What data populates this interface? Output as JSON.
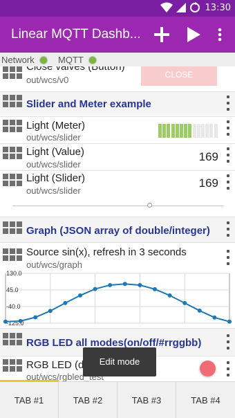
{
  "status_bar": {
    "time": "13:30"
  },
  "app_bar": {
    "title": "Linear MQTT Dashb...",
    "actions": [
      "add-icon",
      "play-icon",
      "overflow-menu-icon"
    ]
  },
  "connection": {
    "network_label": "Network",
    "mqtt_label": "MQTT",
    "network_status_color": "#7cb342",
    "mqtt_status_color": "#7cb342"
  },
  "widgets": {
    "close_valves": {
      "name": "Close valves (Button)",
      "topic": "out/wcs/v0",
      "button_label": "CLOSE"
    },
    "group_slider_meter": {
      "name": "Slider and Meter example"
    },
    "light_meter": {
      "name": "Light (Meter)",
      "topic": "out/wcs/slider",
      "filled_segments": 8,
      "total_segments": 14
    },
    "light_value": {
      "name": "Light (Value)",
      "topic": "out/wcs/slider",
      "value": "169"
    },
    "light_slider": {
      "name": "Light (Slider)",
      "topic": "out/wcs/slider",
      "value": "169"
    },
    "slider_control": {
      "position_fraction": 0.65
    },
    "group_graph": {
      "name": "Graph (JSON array of double/integer)"
    },
    "graph": {
      "name": "Source sin(x), refresh in 3 seconds",
      "topic": "out/wcs/graph"
    },
    "group_rgb": {
      "name": "RGB LED all modes(on/off/#rrggbb)"
    },
    "rgb_led": {
      "name": "RGB LED (defa",
      "topic": "out/wcs/rgbled_test",
      "color": "#f06b73"
    }
  },
  "toast": {
    "text": "Edit mode"
  },
  "tabs": [
    {
      "label": "TAB #1",
      "active": true
    },
    {
      "label": "TAB #2",
      "active": false
    },
    {
      "label": "TAB #3",
      "active": false
    },
    {
      "label": "TAB #4",
      "active": false
    }
  ],
  "colors": {
    "status_bar": "#7b1fa2",
    "app_bar": "#9c27b0",
    "group_title": "#283593",
    "meter_fill": "#9ccc65",
    "meter_empty": "#e8e8e8",
    "graph_line": "#1f77b4",
    "tab_indicator": "#fbc02d"
  },
  "chart_data": {
    "type": "line",
    "title": "",
    "xlabel": "",
    "ylabel": "",
    "y_ticks": [
      "130.0",
      "45.0",
      "-40.0",
      "-125.0"
    ],
    "ylim": [
      -125,
      130
    ],
    "x": [
      0,
      1,
      2,
      3,
      4,
      5,
      6,
      7,
      8,
      9,
      10,
      11,
      12,
      13,
      14,
      15
    ],
    "values": [
      -117,
      -114,
      -95,
      -62,
      -22,
      17,
      50,
      70,
      76,
      70,
      49,
      17,
      -22,
      -61,
      -96,
      -117
    ],
    "series": [
      {
        "values": [
          -117,
          -114,
          -95,
          -62,
          -22,
          17,
          50,
          70,
          76,
          70,
          49,
          17,
          -22,
          -61,
          -96,
          -117
        ]
      }
    ]
  }
}
